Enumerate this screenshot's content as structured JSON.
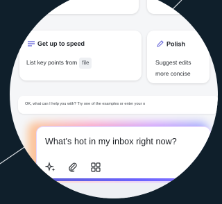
{
  "cards": {
    "left": {
      "title": "Get up to speed",
      "body": "List key points from",
      "chip": "file"
    },
    "right": {
      "title": "Polish",
      "body_line1": "Suggest edits",
      "body_line2": "more concise"
    }
  },
  "hint": {
    "text": "OK, what can I help you with? Try one of the examples or enter your o"
  },
  "prompt": {
    "text": "What's hot in my inbox right now?"
  },
  "icons": {
    "card_left": "list-icon",
    "card_right": "pencil-icon",
    "sparkle": "sparkle-icon",
    "attach": "paperclip-icon",
    "apps": "apps-icon"
  },
  "colors": {
    "accent": "#5b5bd6",
    "background": "#0f1f2b"
  }
}
